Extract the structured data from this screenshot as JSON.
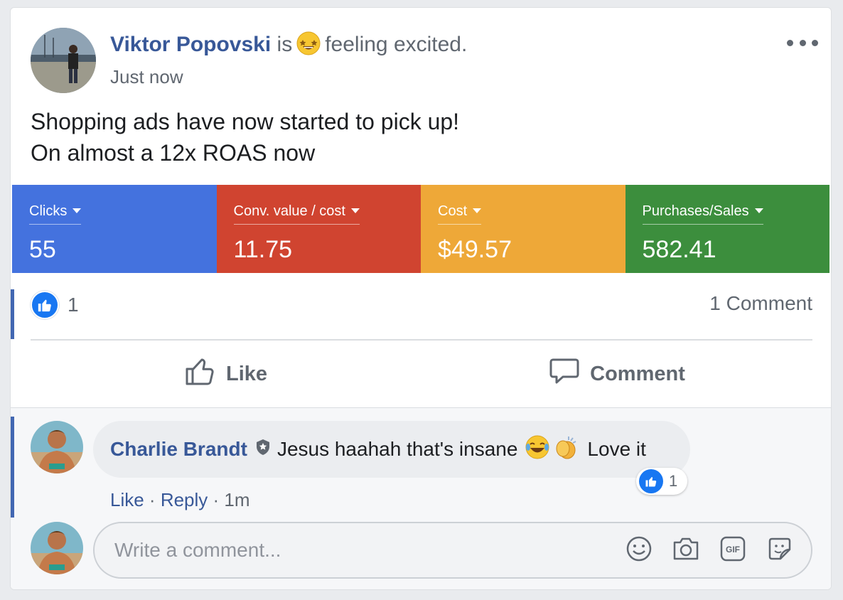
{
  "post": {
    "author_name": "Viktor Popovski",
    "feeling_prefix": "is",
    "feeling_text": "feeling excited.",
    "timestamp": "Just now",
    "text_line1": "Shopping ads have now started to pick up!",
    "text_line2": "On almost a 12x ROAS now"
  },
  "metrics": [
    {
      "label": "Clicks",
      "value": "55",
      "color": "#4472de"
    },
    {
      "label": "Conv. value / cost",
      "value": "11.75",
      "color": "#d04430"
    },
    {
      "label": "Cost",
      "value": "$49.57",
      "color": "#eea838"
    },
    {
      "label": "Purchases/Sales",
      "value": "582.41",
      "color": "#3c8e3d"
    }
  ],
  "reactions": {
    "like_count": "1",
    "comment_count": "1 Comment"
  },
  "actions": {
    "like_label": "Like",
    "comment_label": "Comment"
  },
  "comment": {
    "author": "Charlie Brandt",
    "text_main": "Jesus haahah that's insane",
    "text_end": "Love it",
    "reaction_count": "1",
    "like_link": "Like",
    "sep1": " · ",
    "reply_link": "Reply",
    "sep2": " · ",
    "time": "1m"
  },
  "composer": {
    "placeholder": "Write a comment..."
  },
  "icons": [
    "more-icon",
    "star-struck-emoji-icon",
    "like-icon",
    "thumbs-up-outline-icon",
    "speech-bubble-icon",
    "shield-badge-icon",
    "laughing-emoji-icon",
    "clapping-emoji-icon",
    "smiley-icon",
    "camera-icon",
    "gif-icon",
    "sticker-icon"
  ]
}
